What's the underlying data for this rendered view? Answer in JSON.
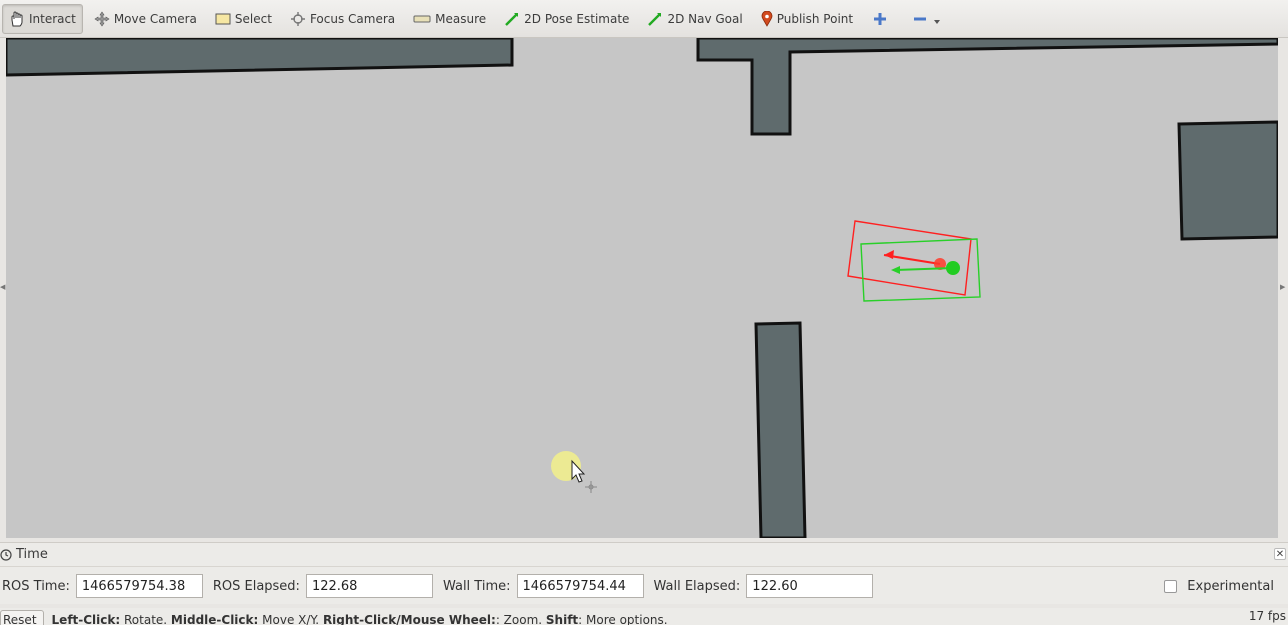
{
  "toolbar": {
    "tools": [
      {
        "label": "Interact",
        "icon": "hand-icon"
      },
      {
        "label": "Move Camera",
        "icon": "move-camera-icon"
      },
      {
        "label": "Select",
        "icon": "select-icon"
      },
      {
        "label": "Focus Camera",
        "icon": "focus-camera-icon"
      },
      {
        "label": "Measure",
        "icon": "measure-icon"
      },
      {
        "label": "2D Pose Estimate",
        "icon": "pose-arrow-icon"
      },
      {
        "label": "2D Nav Goal",
        "icon": "nav-goal-arrow-icon"
      },
      {
        "label": "Publish Point",
        "icon": "map-pin-icon"
      }
    ],
    "active_tool": "Interact"
  },
  "time_panel": {
    "title": "Time",
    "ros_time_label": "ROS Time:",
    "ros_time": "1466579754.38",
    "ros_elapsed_label": "ROS Elapsed:",
    "ros_elapsed": "122.68",
    "wall_time_label": "Wall Time:",
    "wall_time": "1466579754.44",
    "wall_elapsed_label": "Wall Elapsed:",
    "wall_elapsed": "122.60",
    "experimental_label": "Experimental",
    "experimental_checked": false
  },
  "statusbar": {
    "reset_label": "Reset",
    "hint_left_key": "Left-Click:",
    "hint_left_val": " Rotate. ",
    "hint_middle_key": "Middle-Click:",
    "hint_middle_val": " Move X/Y. ",
    "hint_right_key": "Right-Click/Mouse Wheel:",
    "hint_right_val": ": Zoom. ",
    "hint_shift_key": "Shift",
    "hint_shift_val": ": More options.",
    "fps": "17 fps"
  },
  "colors": {
    "map_free": "#c6c6c6",
    "map_obstacle": "#5f6b6d",
    "robot_estimate": "#ff2a2a",
    "robot_goal": "#22cc22"
  }
}
